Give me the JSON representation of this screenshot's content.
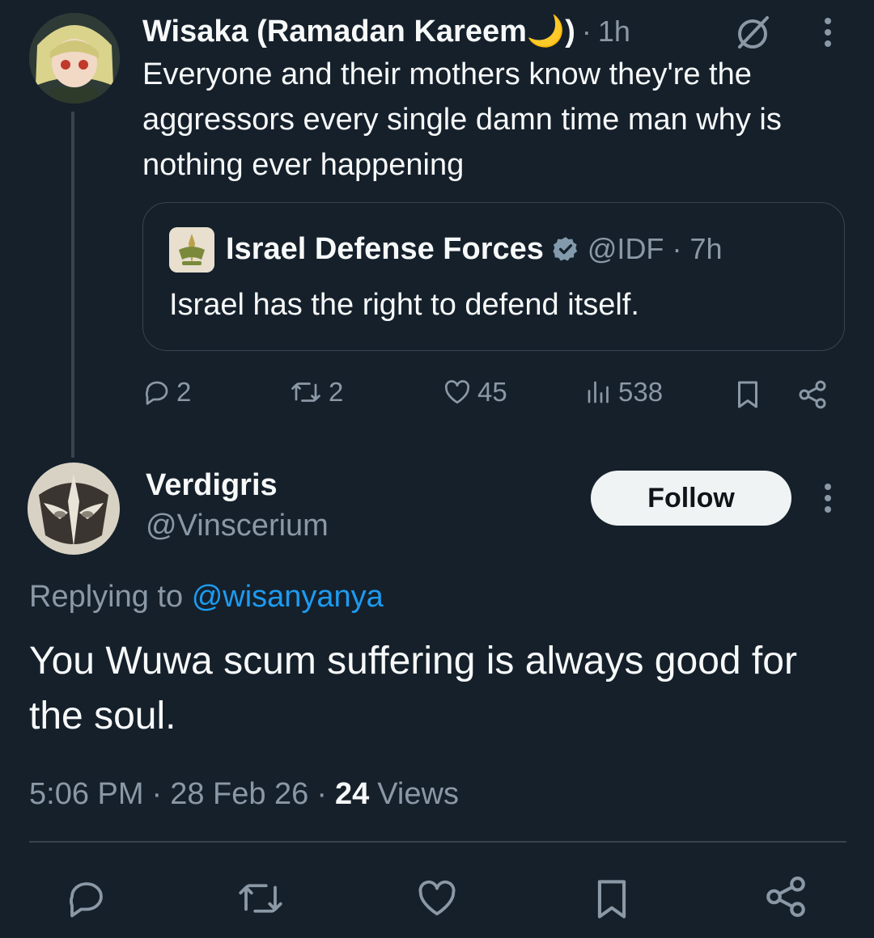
{
  "parent_tweet": {
    "display_name": "Wisaka (Ramadan Kareem",
    "display_name_emoji": "🌙",
    "display_name_close": ")",
    "dot": "·",
    "time": "1h",
    "text": "Everyone and their mothers know they're the aggressors every single damn time man why is nothing ever happening",
    "quote": {
      "display_name": "Israel Defense Forces",
      "handle": "@IDF",
      "dot": "·",
      "time": "7h",
      "text": "Israel has the right to defend itself."
    },
    "actions": {
      "replies": "2",
      "reposts": "2",
      "likes": "45",
      "views": "538"
    }
  },
  "main_tweet": {
    "display_name": "Verdigris",
    "handle": "@Vinscerium",
    "follow_label": "Follow",
    "replying_prefix": "Replying to",
    "replying_handle": "@wisanyanya",
    "text": "You Wuwa scum suffering is always good for the soul.",
    "time": "5:06 PM",
    "date": "28 Feb 26",
    "views_count": "24",
    "views_label": "Views"
  },
  "colors": {
    "background": "#15202b",
    "text": "#f7f9f9",
    "muted": "#8b98a5",
    "link": "#1d9bf0",
    "border": "#38444d",
    "thread_line": "#38444d"
  }
}
